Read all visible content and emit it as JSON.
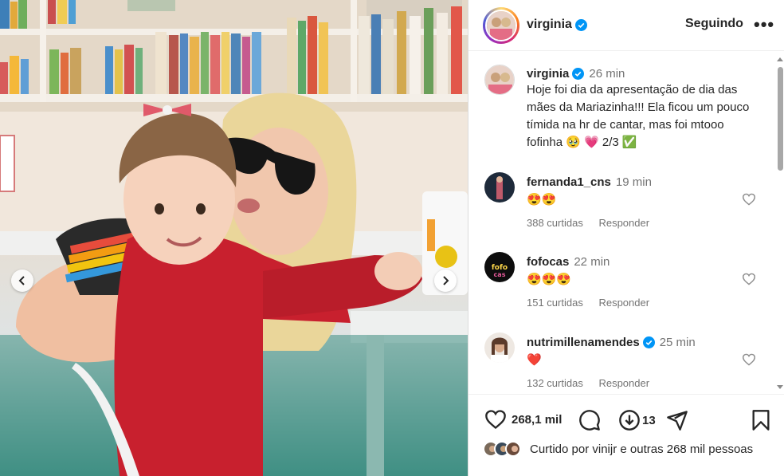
{
  "header": {
    "username": "virginia",
    "follow_label": "Seguindo",
    "more_label": "•••"
  },
  "caption": {
    "username": "virginia",
    "time": "26 min",
    "text": "Hoje foi dia da apresentação de dia das mães da Mariazinha!!! Ela ficou um pouco tímida na hr de cantar, mas foi mtooo fofinha 🥹 💗 2/3 ✅"
  },
  "comments": [
    {
      "username": "fernanda1_cns",
      "time": "19 min",
      "text": "😍😍",
      "likes": "388 curtidas",
      "reply": "Responder",
      "verified": false
    },
    {
      "username": "fofocas",
      "time": "22 min",
      "text": "😍😍😍",
      "likes": "151 curtidas",
      "reply": "Responder",
      "verified": false
    },
    {
      "username": "nutrimillenamendes",
      "time": "25 min",
      "text": "❤️",
      "likes": "132 curtidas",
      "reply": "Responder",
      "verified": true
    }
  ],
  "actions": {
    "likes_count": "268,1 mil",
    "reposts_count": "13"
  },
  "liked_by": {
    "text": "Curtido por vinijr e outras 268 mil pessoas"
  },
  "colors": {
    "verified": "#0095f6",
    "heart": "#ed4956",
    "text": "#262626",
    "muted": "#737373"
  }
}
